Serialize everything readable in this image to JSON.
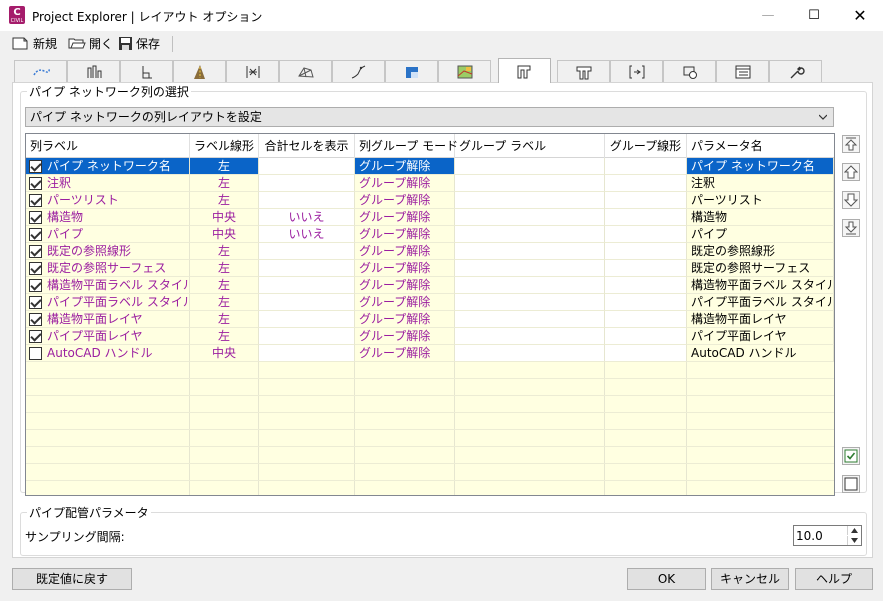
{
  "window": {
    "icon_letter": "C",
    "icon_sub": "CIVIL",
    "title": "Project Explorer | レイアウト オプション",
    "minimize": "—",
    "maximize": "☐",
    "close": "✕"
  },
  "toolbar": {
    "new_label": "新規",
    "open_label": "開く",
    "save_label": "保存"
  },
  "tabs": [
    {
      "icon": "alignment-icon"
    },
    {
      "icon": "profile-icon"
    },
    {
      "icon": "profile-view-icon"
    },
    {
      "icon": "corridor-icon"
    },
    {
      "icon": "sample-line-icon"
    },
    {
      "icon": "surface-icon"
    },
    {
      "icon": "feature-line-icon"
    },
    {
      "icon": "parcel-icon"
    },
    {
      "icon": "point-group-icon"
    },
    {
      "icon": "pipe-network-icon",
      "active": true
    },
    {
      "icon": "pressure-network-icon"
    },
    {
      "icon": "catchment-icon"
    },
    {
      "icon": "assembly-icon"
    },
    {
      "icon": "data-table-icon"
    },
    {
      "icon": "settings-wrench-icon"
    }
  ],
  "section": {
    "title": "パイプ ネットワーク列の選択",
    "combo_value": "パイプ ネットワークの列レイアウトを設定"
  },
  "grid": {
    "headers": [
      "列ラベル",
      "ラベル線形",
      "合計セルを表示",
      "列グループ モード",
      "グループ ラベル",
      "グループ線形",
      "パラメータ名"
    ],
    "rows": [
      {
        "checked": true,
        "label": "パイプ ネットワーク名",
        "align": "左",
        "total": "",
        "group_mode": "グループ解除",
        "group_label": "",
        "group_align": "",
        "param": "パイプ ネットワーク名",
        "selected": true
      },
      {
        "checked": true,
        "label": "注釈",
        "align": "左",
        "total": "",
        "group_mode": "グループ解除",
        "group_label": "",
        "group_align": "",
        "param": "注釈"
      },
      {
        "checked": true,
        "label": "パーツリスト",
        "align": "左",
        "total": "",
        "group_mode": "グループ解除",
        "group_label": "",
        "group_align": "",
        "param": "パーツリスト"
      },
      {
        "checked": true,
        "label": "構造物",
        "align": "中央",
        "total": "いいえ",
        "group_mode": "グループ解除",
        "group_label": "",
        "group_align": "",
        "param": "構造物"
      },
      {
        "checked": true,
        "label": "パイプ",
        "align": "中央",
        "total": "いいえ",
        "group_mode": "グループ解除",
        "group_label": "",
        "group_align": "",
        "param": "パイプ"
      },
      {
        "checked": true,
        "label": "既定の参照線形",
        "align": "左",
        "total": "",
        "group_mode": "グループ解除",
        "group_label": "",
        "group_align": "",
        "param": "既定の参照線形"
      },
      {
        "checked": true,
        "label": "既定の参照サーフェス",
        "align": "左",
        "total": "",
        "group_mode": "グループ解除",
        "group_label": "",
        "group_align": "",
        "param": "既定の参照サーフェス"
      },
      {
        "checked": true,
        "label": "構造物平面ラベル スタイル",
        "align": "左",
        "total": "",
        "group_mode": "グループ解除",
        "group_label": "",
        "group_align": "",
        "param": "構造物平面ラベル スタイル"
      },
      {
        "checked": true,
        "label": "パイプ平面ラベル スタイル",
        "align": "左",
        "total": "",
        "group_mode": "グループ解除",
        "group_label": "",
        "group_align": "",
        "param": "パイプ平面ラベル スタイル"
      },
      {
        "checked": true,
        "label": "構造物平面レイヤ",
        "align": "左",
        "total": "",
        "group_mode": "グループ解除",
        "group_label": "",
        "group_align": "",
        "param": "構造物平面レイヤ"
      },
      {
        "checked": true,
        "label": "パイプ平面レイヤ",
        "align": "左",
        "total": "",
        "group_mode": "グループ解除",
        "group_label": "",
        "group_align": "",
        "param": "パイプ平面レイヤ"
      },
      {
        "checked": false,
        "label": "AutoCAD ハンドル",
        "align": "中央",
        "total": "",
        "group_mode": "グループ解除",
        "group_label": "",
        "group_align": "",
        "param": "AutoCAD ハンドル"
      }
    ]
  },
  "side_buttons": [
    "move-top-icon",
    "move-up-icon",
    "move-down-icon",
    "move-bottom-icon",
    "check-all-icon",
    "uncheck-all-icon"
  ],
  "pipe_params": {
    "title": "パイプ配管パラメータ",
    "sampling_label": "サンプリング間隔:",
    "sampling_value": "10.0"
  },
  "buttons": {
    "reset": "既定値に戻す",
    "ok": "OK",
    "cancel": "キャンセル",
    "help": "ヘルプ"
  },
  "colors": {
    "purple_text": "#9b1ea0",
    "selection": "#0a64c8",
    "grid_bg": "#ffffe1",
    "app_icon": "#a51c6b"
  }
}
